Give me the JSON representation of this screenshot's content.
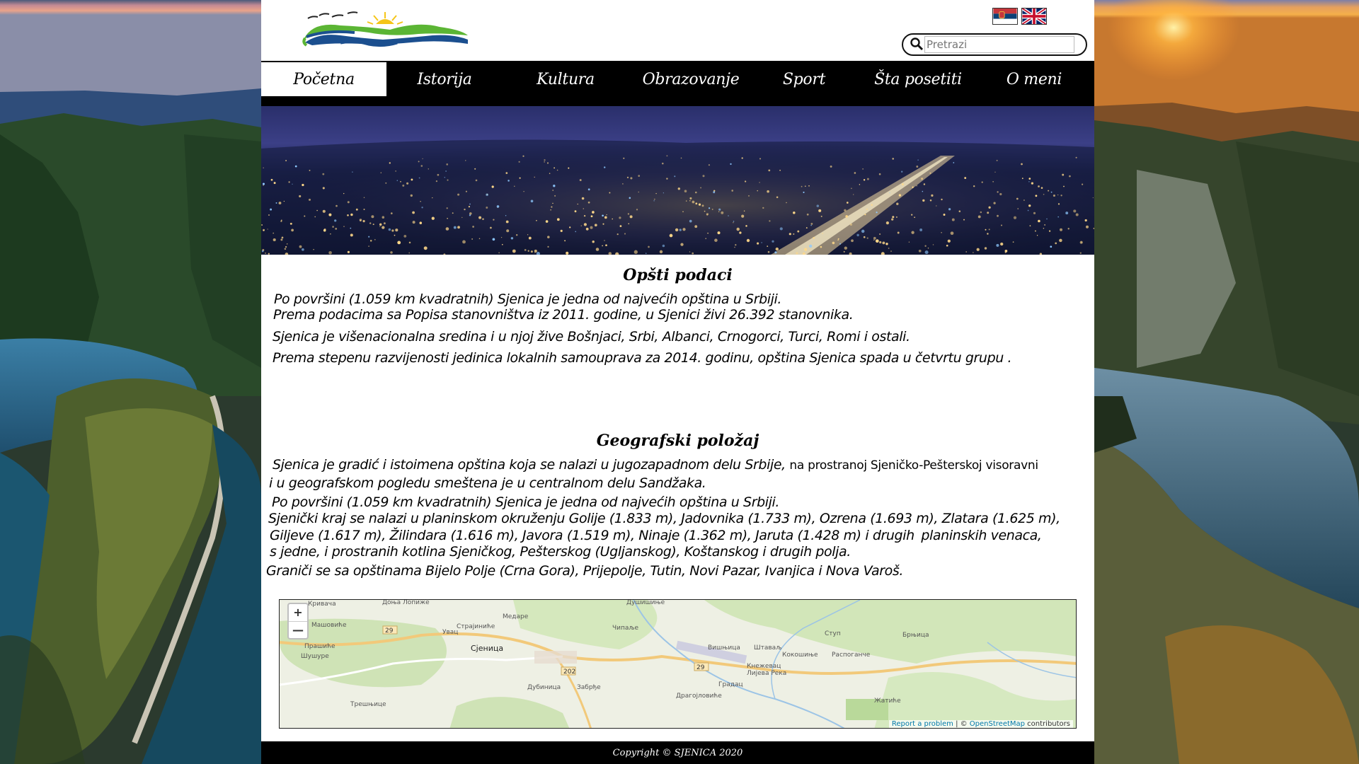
{
  "header": {
    "logo_name": "logo-hills-sun",
    "flags": [
      {
        "name": "serbian-flag-icon",
        "alt": "Srpski"
      },
      {
        "name": "uk-flag-icon",
        "alt": "English"
      }
    ],
    "search": {
      "placeholder": "Pretrazi"
    }
  },
  "nav": {
    "items": [
      {
        "label": "Početna",
        "active": true
      },
      {
        "label": "Istorija",
        "active": false
      },
      {
        "label": "Kultura",
        "active": false
      },
      {
        "label": "Obrazovanje",
        "active": false
      },
      {
        "label": "Sport",
        "active": false
      },
      {
        "label": "Šta posetiti",
        "active": false
      },
      {
        "label": "O meni",
        "active": false
      }
    ]
  },
  "general": {
    "title": "Opšti podaci",
    "lines": [
      "Po površini (1.059 km kvadratnih) Sjenica je jedna od najvećih opština u Srbiji.",
      "Prema podacima sa Popisa stanovništva iz 2011. godine, u Sjenici živi 26.392 stanovnika.",
      "Sjenica je višenacionalna sredina i u njoj žive Bošnjaci, Srbi, Albanci, Crnogorci, Turci, Romi i ostali.",
      "Prema stepenu razvijenosti jedinica lokalnih samouprava za 2014. godinu, opština Sjenica spada u četvrtu grupu ."
    ]
  },
  "geo": {
    "title": "Geografski položaj",
    "line1_main": "Sjenica je gradić i istoimena opština koja se nalazi u jugozapadnom delu Srbije,",
    "line1_small": "na prostranoj Sjeničko-Pešterskoj visoravni",
    "line2": "i u geografskom pogledu smeštena je u centralnom delu Sandžaka.",
    "line3": "Po površini (1.059 km kvadratnih) Sjenica je jedna od najvećih opština u Srbiji.",
    "line4": "Sjenički kraj se nalazi u planinskom okruženju Golije (1.833 m), Jadovnika (1.733 m), Ozrena (1.693 m), Zlatara (1.625 m),",
    "line5_main": "Giljeve (1.617 m), Žilindara (1.616 m), Javora (1.519 m), Ninaje (1.362 m), Jaruta (1.428 m) i drugih",
    "line5_tail": "planinskih venaca,",
    "line6": "s jedne, i prostranih kotlina Sjeničkog, Pešterskog (Ugljanskog), Koštanskog i drugih polja.",
    "line7": "Graniči se sa opštinama Bijelo Polje (Crna Gora), Prijepolje, Tutin, Novi Pazar, Ivanjica i Nova Varoš."
  },
  "map": {
    "zoom_in": "+",
    "zoom_out": "—",
    "attribution_report": "Report a problem",
    "attribution_sep": " | © ",
    "attribution_osm": "OpenStreetMap",
    "attribution_tail": " contributors",
    "labels": [
      "Кривача",
      "Доња Лопиже",
      "Душишиње",
      "Страјиниће",
      "Медаре",
      "Машовиће",
      "Увац",
      "Чипаље",
      "Прашиће",
      "Вишњица",
      "Шушуре",
      "Штаваљ",
      "Кокошиње",
      "Распоганче",
      "Ступ",
      "Брњица",
      "Сјеница",
      "Лијева Река",
      "Дубиница",
      "Забрђе",
      "Драгојловиће",
      "Кнежевац",
      "Градац",
      "Жатиће",
      "Трешњице"
    ],
    "road_numbers": [
      "29",
      "202",
      "29"
    ]
  },
  "footer": {
    "copyright": "Copyright © SJENICA 2020"
  }
}
